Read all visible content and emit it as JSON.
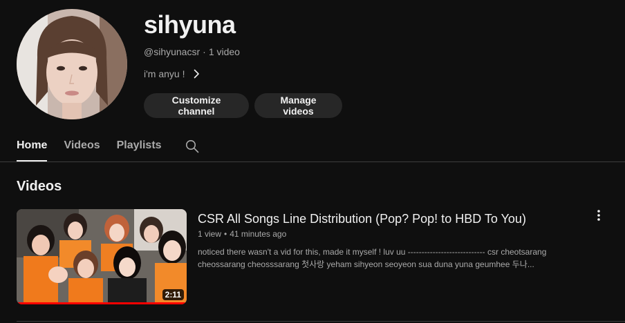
{
  "channel": {
    "name": "sihyuna",
    "handle": "@sihyunacsr",
    "separator": "·",
    "video_count": "1 video",
    "about": "i'm anyu !"
  },
  "actions": {
    "customize": "Customize channel",
    "manage": "Manage videos"
  },
  "tabs": [
    {
      "label": "Home",
      "active": true
    },
    {
      "label": "Videos",
      "active": false
    },
    {
      "label": "Playlists",
      "active": false
    }
  ],
  "section": {
    "title": "Videos"
  },
  "video": {
    "title": "CSR All Songs Line Distribution (Pop? Pop! to HBD To You)",
    "views": "1 view",
    "dot": "•",
    "age": "41 minutes ago",
    "description": "noticed there wasn't a vid for this, made it myself ! luv uu ---------------------------- csr cheotsarang cheossarang cheosssarang 첫사랑 yeham sihyeon seoyeon sua duna yuna geumhee 두나...",
    "duration": "2:11",
    "watched_fraction": 1.0
  },
  "icons": {
    "search": "search-icon",
    "chevron": "chevron-right-icon",
    "more": "more-vert-icon"
  },
  "colors": {
    "background": "#0f0f0f",
    "button_bg": "#272727",
    "text_primary": "#f1f1f1",
    "text_secondary": "#aaaaaa",
    "progress": "#ff0000"
  }
}
